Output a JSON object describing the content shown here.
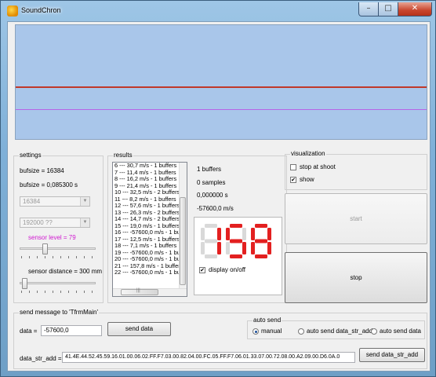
{
  "window": {
    "title": "SoundChron",
    "min_glyph": "–",
    "max_glyph": "□",
    "close_glyph": "✕"
  },
  "settings": {
    "title": "settings",
    "bufsize_label": "bufsize = 16384",
    "bufsize_s_label": "bufsize = 0,085300 s",
    "bufsize_combo": "16384",
    "rate_combo": "192000 ??",
    "sensor_level_label": "sensor level = 79",
    "sensor_distance_label": "sensor distance = 300 mm"
  },
  "results": {
    "title": "results",
    "items": [
      "6 --- 30,7 m/s - 1 buffers",
      "7 --- 11,4 m/s - 1 buffers",
      "8 --- 16,2 m/s - 1 buffers",
      "9 --- 21,4 m/s - 1 buffers",
      "10 --- 32,5 m/s - 2 buffers",
      "11 --- 8,2 m/s - 1 buffers",
      "12 --- 57,6 m/s - 1 buffers",
      "13 --- 26,3 m/s - 2 buffers",
      "14 --- 14,7 m/s - 2 buffers",
      "15 --- 19,0 m/s - 1 buffers",
      "16 --- -57600,0 m/s - 1 buf",
      "17 --- 12,5 m/s - 1 buffers",
      "18 --- 7,1 m/s - 1 buffers",
      "19 --- -57600,0 m/s - 1 buf",
      "20 --- -57600,0 m/s - 1 buf",
      "21 --- 157,8 m/s - 1 buffer",
      "22 --- -57600,0 m/s - 1 buf"
    ],
    "buffers": "1 buffers",
    "samples": "0 samples",
    "seconds": "0,000000 s",
    "speed": "-57600,0 m/s",
    "digits": "158",
    "display_checkbox_label": "display on/off",
    "display_checked": true
  },
  "visualization": {
    "title": "visualization",
    "stop_at_shoot_label": "stop at shoot",
    "stop_at_shoot_checked": false,
    "show_label": "show",
    "show_checked": true
  },
  "actions": {
    "start_label": "start",
    "stop_label": "stop"
  },
  "send": {
    "title": "send message to 'TfrmMain'",
    "data_label": "data =",
    "data_value": "-57600,0",
    "send_data_label": "send data",
    "data_str_add_label": "data_str_add =",
    "data_str_add_value": "41.4E.44.52.45.59.16.01.00.06.02.FF.F7.03.00.82.04.00.FC.05.FF.F7.06.01.33.07.00.72.08.00.A2.09.00.D6.0A.0",
    "send_data_str_add_label": "send data_str_add",
    "auto_send": {
      "title": "auto send",
      "options": [
        "manual",
        "auto send data_str_add",
        "auto send data"
      ],
      "selected": "manual"
    }
  },
  "colors": {
    "plot_bg": "#a9c6ea",
    "signal_line": "#c0392b",
    "threshold_line": "#b765e8",
    "sensor_level_text": "#d01ad0",
    "digit_on": "#e32020",
    "digit_off": "#d9d9d9"
  }
}
